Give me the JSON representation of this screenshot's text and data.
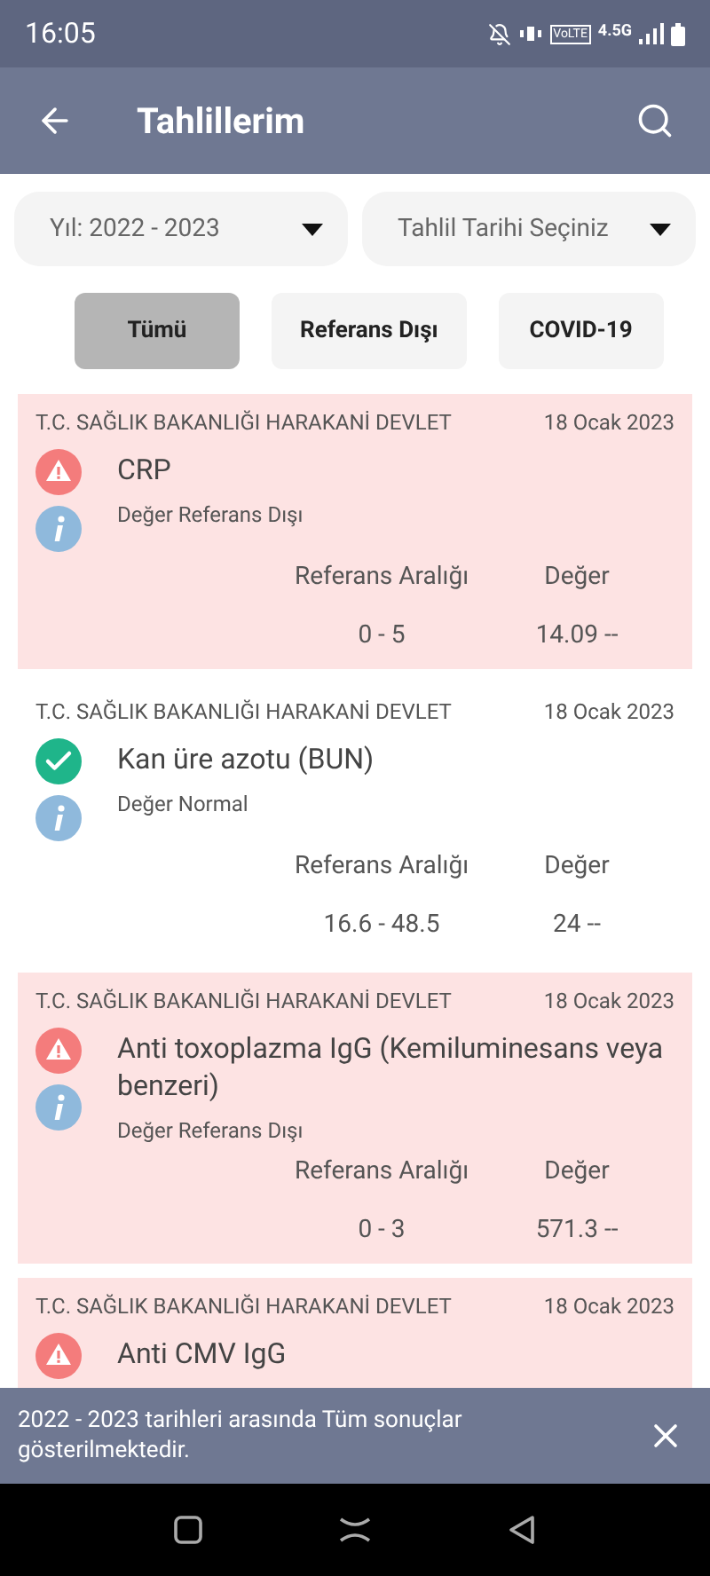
{
  "status_bar": {
    "time": "16:05",
    "network_labels": [
      "VoLTE",
      "4.5G"
    ]
  },
  "header": {
    "title": "Tahlillerim"
  },
  "filters": [
    {
      "label": "Yıl: 2022 - 2023"
    },
    {
      "label": "Tahlil Tarihi Seçiniz"
    }
  ],
  "tabs": [
    {
      "label": "Tümü",
      "selected": true
    },
    {
      "label": "Referans Dışı",
      "selected": false
    },
    {
      "label": "COVID-19",
      "selected": false
    }
  ],
  "results": [
    {
      "institution": "T.C. SAĞLIK BAKANLIĞI HARAKANİ DEVLET",
      "date": "18 Ocak 2023",
      "test": "CRP",
      "kind": "out",
      "note": "Değer Referans Dışı",
      "range_label": "Referans Aralığı",
      "value_label": "Değer",
      "range": "0 - 5",
      "value": "14.09 --"
    },
    {
      "institution": "T.C. SAĞLIK BAKANLIĞI HARAKANİ DEVLET",
      "date": "18 Ocak 2023",
      "test": "Kan üre azotu (BUN)",
      "kind": "normal",
      "note": "Değer Normal",
      "range_label": "Referans Aralığı",
      "value_label": "Değer",
      "range": "16.6 - 48.5",
      "value": "24 --"
    },
    {
      "institution": "T.C. SAĞLIK BAKANLIĞI HARAKANİ DEVLET",
      "date": "18 Ocak 2023",
      "test": "Anti toxoplazma IgG (Kemiluminesans veya benzeri)",
      "kind": "out",
      "note": "Değer Referans Dışı",
      "range_label": "Referans Aralığı",
      "value_label": "Değer",
      "range": "0 - 3",
      "value": "571.3 --"
    },
    {
      "institution": "T.C. SAĞLIK BAKANLIĞI HARAKANİ DEVLET",
      "date": "18 Ocak 2023",
      "test": "Anti CMV IgG",
      "kind": "out"
    }
  ],
  "snackbar": {
    "message": "2022 - 2023 tarihleri arasında Tüm sonuçlar gösterilmektedir."
  }
}
